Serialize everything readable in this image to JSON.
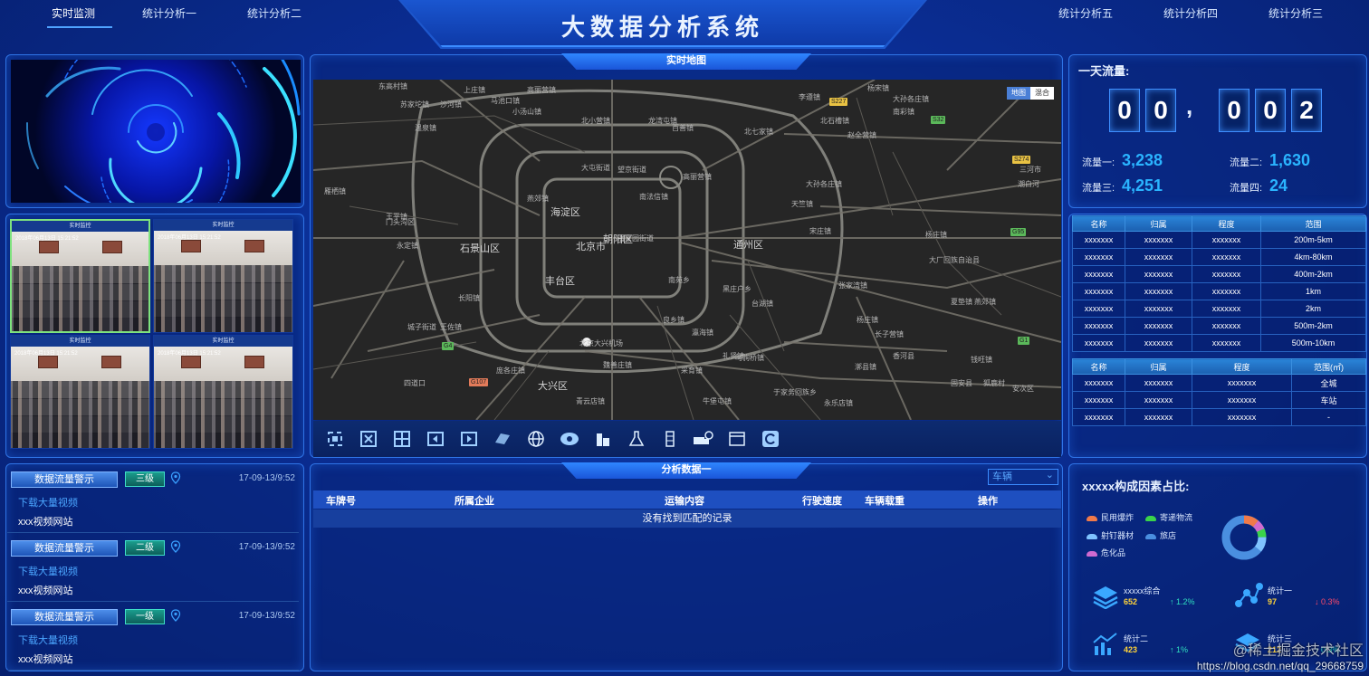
{
  "header": {
    "title": "大数据分析系统",
    "nav_left": [
      "实时监测",
      "统计分析一",
      "统计分析二"
    ],
    "nav_right": [
      "统计分析五",
      "统计分析四",
      "统计分析三"
    ],
    "active_nav": "实时监测"
  },
  "videos": [
    {
      "title": "实时监控",
      "time": "2018年06月13日 15:21:52"
    },
    {
      "title": "实时监控",
      "time": "2018年06月13日 15:21:52"
    },
    {
      "title": "实时监控",
      "time": "2018年06月13日 15:21:52"
    },
    {
      "title": "实时监控",
      "time": "2018年06月13日 15:21:52"
    }
  ],
  "alerts": [
    {
      "button": "数据流量警示",
      "level": "三级",
      "time": "17-09-13/9:52",
      "link": "下载大量视频",
      "site": "xxx视频网站"
    },
    {
      "button": "数据流量警示",
      "level": "二级",
      "time": "17-09-13/9:52",
      "link": "下载大量视频",
      "site": "xxx视频网站"
    },
    {
      "button": "数据流量警示",
      "level": "一级",
      "time": "17-09-13/9:52",
      "link": "下载大量视频",
      "site": "xxx视频网站"
    }
  ],
  "map": {
    "title": "实时地图",
    "type_buttons": [
      "地图",
      "混合"
    ],
    "active_type": "地图",
    "labels": [
      "东高村镇",
      "上庄镇",
      "马池口镇",
      "高丽营镇",
      "李遵镇",
      "杨宋镇",
      "大孙各庄镇",
      "苏家坨镇",
      "沙河镇",
      "小汤山镇",
      "北小营镇",
      "龙湾屯镇",
      "温泉镇",
      "百善镇",
      "北七家镇",
      "赵全营镇",
      "南彩镇",
      "北石槽镇",
      "大屯街道",
      "望京街道",
      "高丽营镇",
      "大孙各庄镇",
      "雁栖镇",
      "燕郊镇",
      "南法信镇",
      "天竺镇",
      "王平镇",
      "海淀区",
      "潘家园街道",
      "宋庄镇",
      "门头沟区",
      "北京市",
      "朝阳区",
      "通州区",
      "永定镇",
      "石景山区",
      "长阳镇",
      "丰台区",
      "南苑乡",
      "黑庄户乡",
      "台湖镇",
      "张家湾镇",
      "城子街道",
      "王佐镇",
      "良乡镇",
      "瀛海镇",
      "马驹桥镇",
      "于家务回族乡",
      "大兴区",
      "青云店镇",
      "永乐店镇",
      "漷县镇",
      "长子营镇",
      "牛堡屯镇",
      "礼贤镇",
      "采育镇",
      "魏善庄镇",
      "庞各庄镇",
      "杨庄镇",
      "安次区",
      "固安县",
      "狐鹿村",
      "香河县",
      "钱旺镇",
      "大厂回族自治县",
      "燕郊镇",
      "潮白河",
      "三河市",
      "杨庄镇",
      "夏垫镇",
      "四道口",
      "北京大兴机场"
    ],
    "shields": [
      {
        "text": "S227",
        "color": "#e9c243"
      },
      {
        "text": "S32",
        "color": "#5bb85a"
      },
      {
        "text": "S274",
        "color": "#e9c243"
      },
      {
        "text": "G95",
        "color": "#5bb85a"
      },
      {
        "text": "G4",
        "color": "#5bb85a"
      },
      {
        "text": "G107",
        "color": "#e37b5a"
      },
      {
        "text": "G1",
        "color": "#5bb85a"
      }
    ]
  },
  "analysis": {
    "title": "分析数据一",
    "select_value": "车辆",
    "columns": [
      "车牌号",
      "所属企业",
      "运输内容",
      "行驶速度",
      "车辆载重",
      "操作"
    ],
    "empty_text": "没有找到匹配的记录"
  },
  "flow": {
    "title": "一天流量:",
    "digits": [
      "0",
      "0",
      ",",
      "0",
      "0",
      "2"
    ],
    "stats": [
      {
        "label": "流量一:",
        "value": "3,238"
      },
      {
        "label": "流量二:",
        "value": "1,630"
      },
      {
        "label": "流量三:",
        "value": "4,251"
      },
      {
        "label": "流量四:",
        "value": "24"
      }
    ]
  },
  "table1": {
    "columns": [
      "名称",
      "归属",
      "程度",
      "范围"
    ],
    "rows": [
      [
        "xxxxxxx",
        "xxxxxxx",
        "xxxxxxx",
        "200m-5km"
      ],
      [
        "xxxxxxx",
        "xxxxxxx",
        "xxxxxxx",
        "4km-80km"
      ],
      [
        "xxxxxxx",
        "xxxxxxx",
        "xxxxxxx",
        "400m-2km"
      ],
      [
        "xxxxxxx",
        "xxxxxxx",
        "xxxxxxx",
        "1km"
      ],
      [
        "xxxxxxx",
        "xxxxxxx",
        "xxxxxxx",
        "2km"
      ],
      [
        "xxxxxxx",
        "xxxxxxx",
        "xxxxxxx",
        "500m-2km"
      ],
      [
        "xxxxxxx",
        "xxxxxxx",
        "xxxxxxx",
        "500m-10km"
      ]
    ]
  },
  "table2": {
    "columns": [
      "名称",
      "归属",
      "程度",
      "范围(㎡)"
    ],
    "rows": [
      [
        "xxxxxxx",
        "xxxxxxx",
        "xxxxxxx",
        "全城"
      ],
      [
        "xxxxxxx",
        "xxxxxxx",
        "xxxxxxx",
        "车站"
      ],
      [
        "xxxxxxx",
        "xxxxxxx",
        "xxxxxxx",
        "-"
      ]
    ]
  },
  "factors": {
    "title": "xxxxx构成因素占比:",
    "legend": [
      {
        "name": "民用爆炸",
        "color": "#f07a4a"
      },
      {
        "name": "寄递物流",
        "color": "#3ad44a"
      },
      {
        "name": "射钉器材",
        "color": "#7fc3ff"
      },
      {
        "name": "旅店",
        "color": "#4a8fe0"
      },
      {
        "name": "危化品",
        "color": "#d06ad0"
      }
    ],
    "stats": [
      {
        "name": "xxxxx综合",
        "value": "652",
        "change": "↑ 1.2%",
        "dir": "up"
      },
      {
        "name": "统计一",
        "value": "97",
        "change": "↓ 0.3%",
        "dir": "down"
      },
      {
        "name": "统计二",
        "value": "423",
        "change": "↑ 1%",
        "dir": "up"
      },
      {
        "name": "统计三",
        "value": "212",
        "change": "↑ 0.3%",
        "dir": "up"
      }
    ]
  },
  "watermark": {
    "line1": "@稀土掘金技术社区",
    "line2": "https://blog.csdn.net/qq_29668759"
  }
}
